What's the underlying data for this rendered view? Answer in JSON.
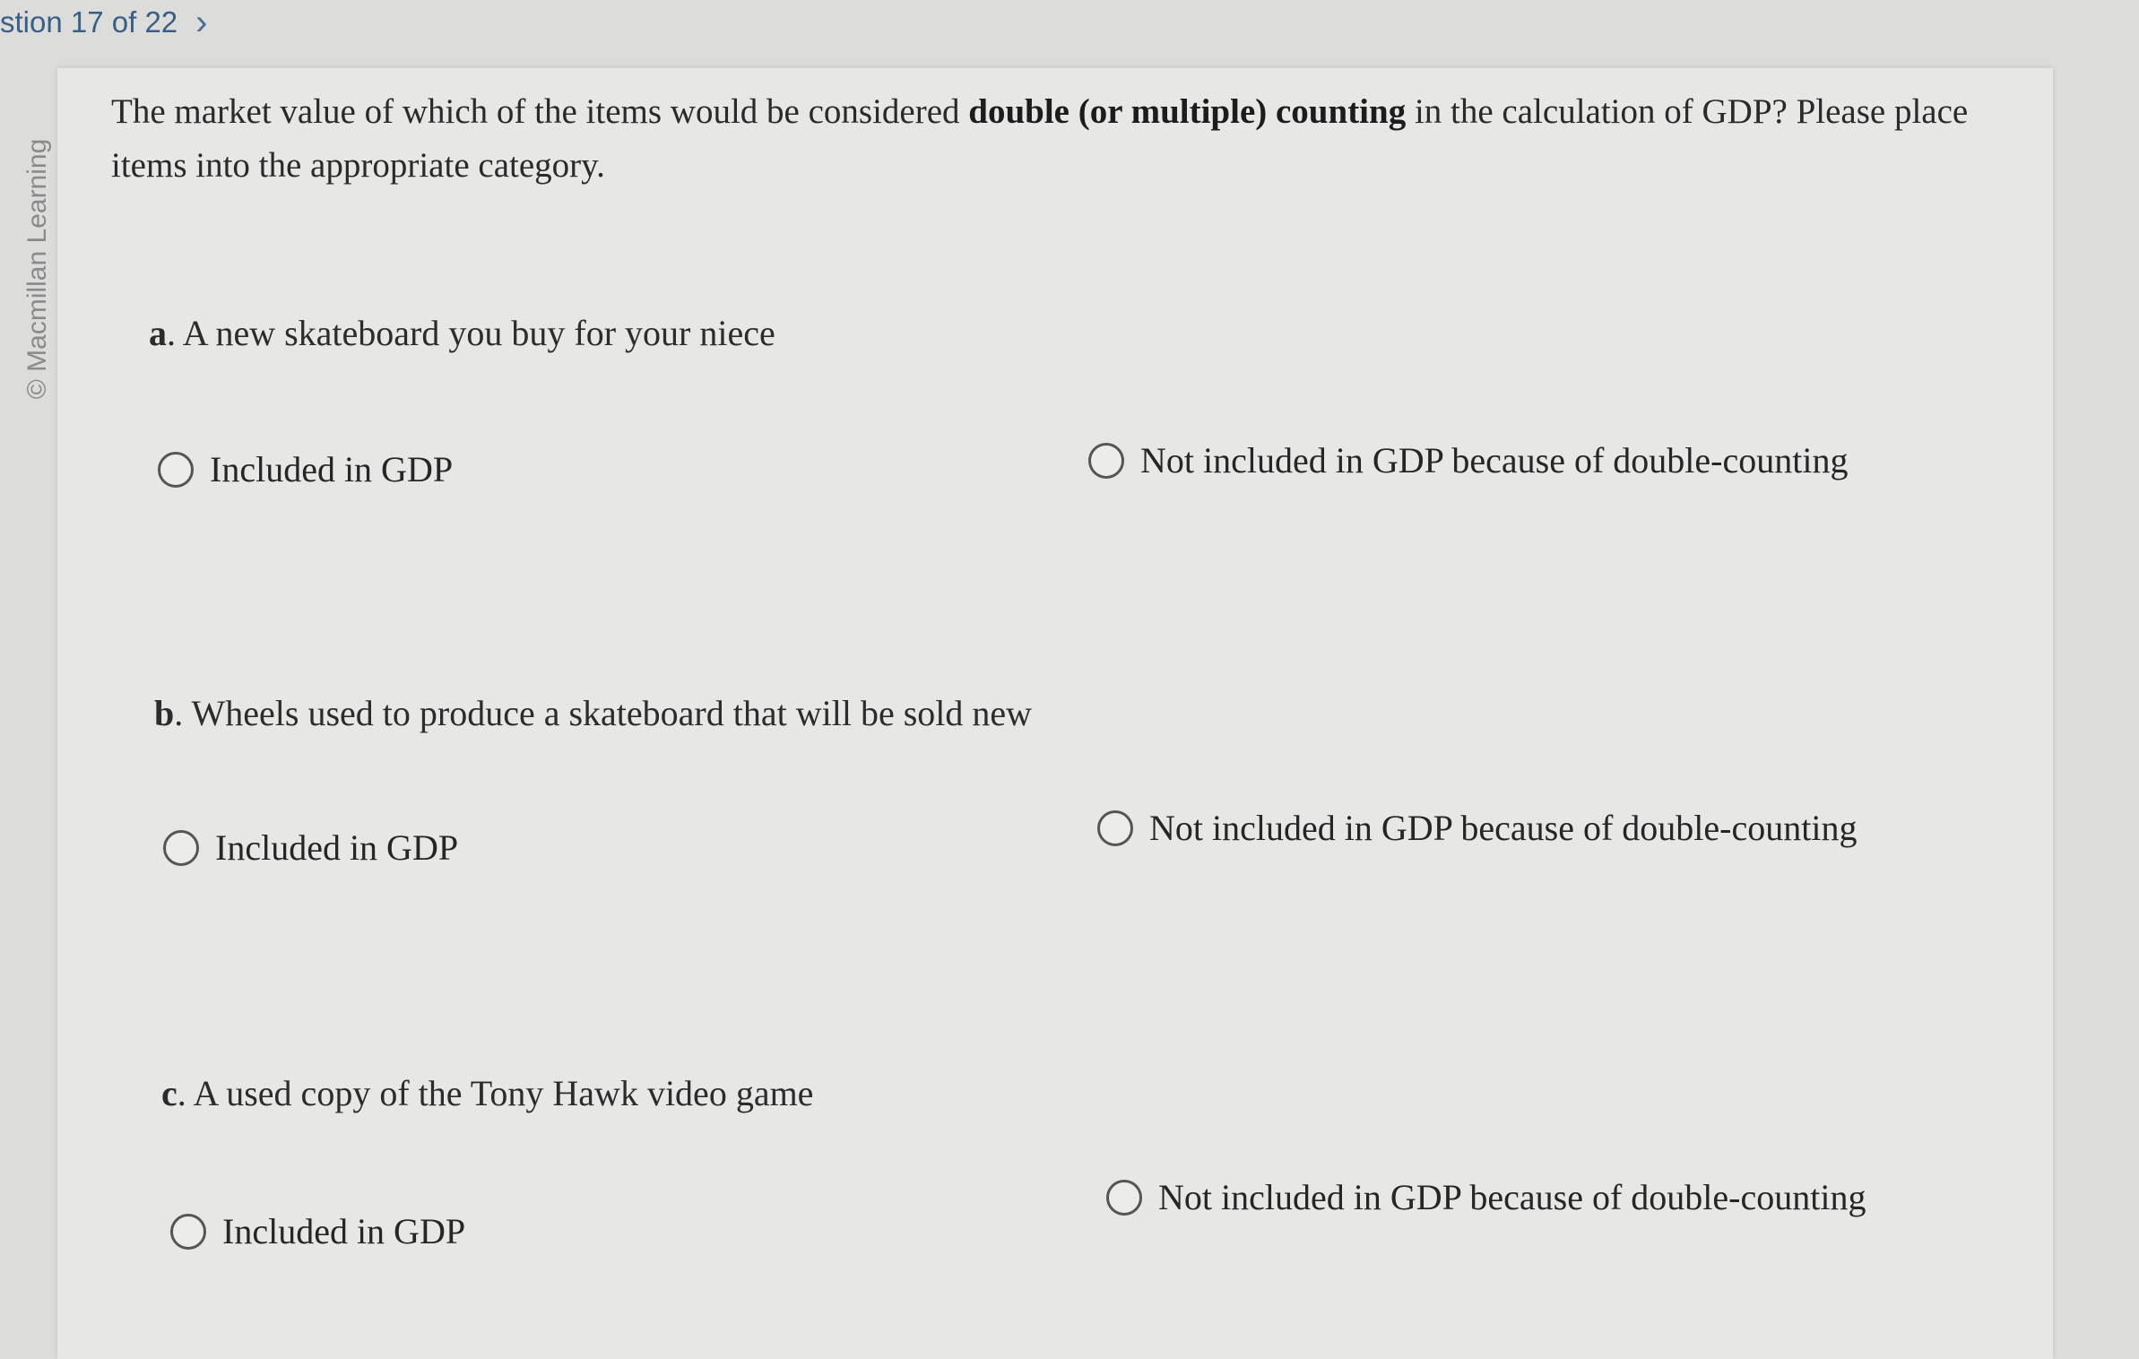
{
  "header": {
    "question_counter": "stion 17 of 22",
    "next_icon": "chevron-right-icon"
  },
  "sidebar": {
    "copyright": "© Macmillan Learning"
  },
  "question": {
    "prompt_part1": "The market value of which of the items would be considered ",
    "prompt_bold": "double (or multiple) counting",
    "prompt_part2": " in the calculation of GDP? Please place items into the appropriate category."
  },
  "items": [
    {
      "letter": "a",
      "text": ". A new skateboard you buy for your niece",
      "option_included": "Included in GDP",
      "option_not_included": "Not included in GDP because of double-counting"
    },
    {
      "letter": "b",
      "text": ". Wheels used to produce a  skateboard that will be sold new",
      "option_included": "Included in GDP",
      "option_not_included": "Not included in GDP because of double-counting"
    },
    {
      "letter": "c",
      "text": ". A used copy of the Tony Hawk video game",
      "option_included": "Included in GDP",
      "option_not_included": "Not included in GDP because of double-counting"
    }
  ]
}
